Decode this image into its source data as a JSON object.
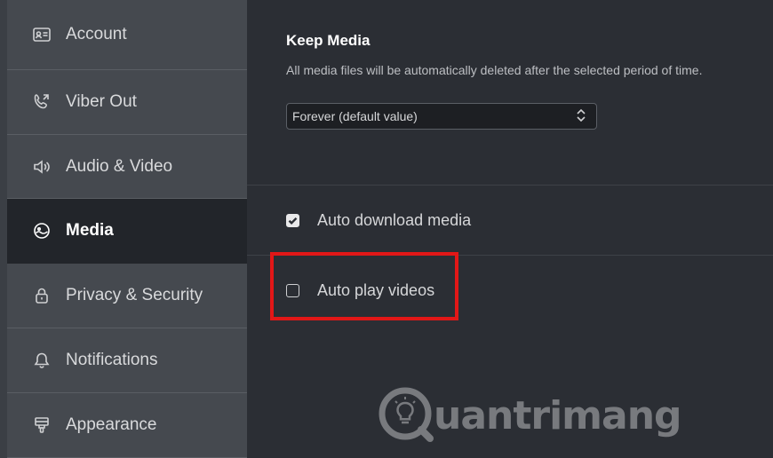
{
  "sidebar": {
    "items": [
      {
        "label": "Account",
        "icon": "account-card-icon",
        "active": false
      },
      {
        "label": "Viber Out",
        "icon": "phone-out-icon",
        "active": false
      },
      {
        "label": "Audio & Video",
        "icon": "speaker-icon",
        "active": false
      },
      {
        "label": "Media",
        "icon": "media-icon",
        "active": true
      },
      {
        "label": "Privacy & Security",
        "icon": "lock-icon",
        "active": false
      },
      {
        "label": "Notifications",
        "icon": "bell-icon",
        "active": false
      },
      {
        "label": "Appearance",
        "icon": "appearance-icon",
        "active": false
      }
    ]
  },
  "main": {
    "keep_media": {
      "title": "Keep Media",
      "description": "All media files will be automatically deleted after the selected period of time.",
      "select_value": "Forever (default value)"
    },
    "options": [
      {
        "label": "Auto download media",
        "checked": true
      },
      {
        "label": "Auto play videos",
        "checked": false
      }
    ]
  },
  "watermark": {
    "text": "uantrimang"
  },
  "colors": {
    "sidebar_bg": "#45494f",
    "sidebar_active_bg": "#22252a",
    "main_bg": "#2b2e34",
    "highlight": "#e21717"
  }
}
